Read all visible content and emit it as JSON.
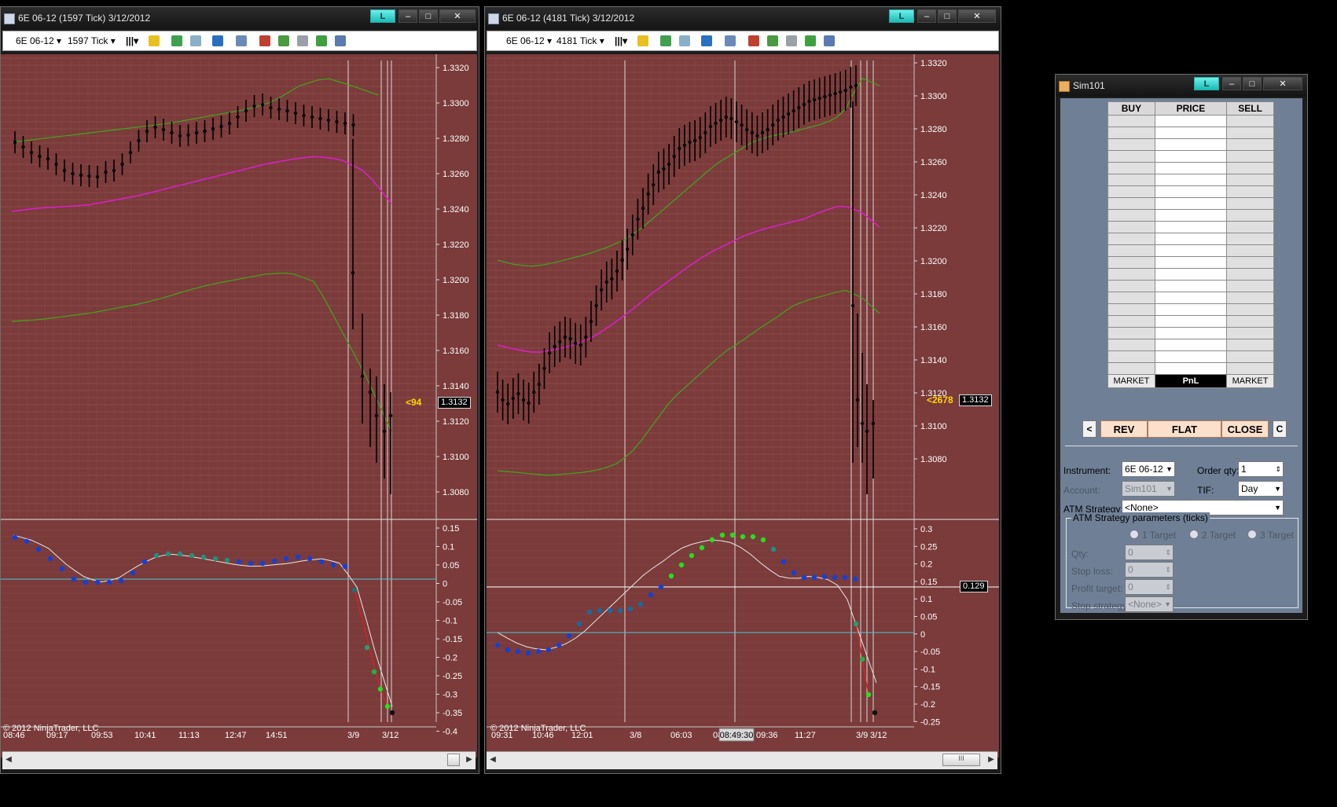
{
  "chart1": {
    "title": "6E 06-12 (1597 Tick)  3/12/2012",
    "instrument": "6E 06-12",
    "period": "1597 Tick",
    "copyright": "© 2012 NinjaTrader, LLC",
    "last_price_tag": "1.3132",
    "counter_tag": "<94",
    "price_ticks": [
      "1.3320",
      "1.3300",
      "1.3280",
      "1.3260",
      "1.3240",
      "1.3220",
      "1.3200",
      "1.3180",
      "1.3160",
      "1.3140",
      "1.3120",
      "1.3100",
      "1.3080"
    ],
    "osc_ticks": [
      "0.15",
      "0.1",
      "0.05",
      "0",
      "-0.05",
      "-0.1",
      "-0.15",
      "-0.2",
      "-0.25",
      "-0.3",
      "-0.35",
      "-0.4"
    ],
    "x_labels": [
      "08:46",
      "09:17",
      "09:53",
      "10:41",
      "11:13",
      "12:47",
      "14:51",
      "3/9",
      "3/12"
    ]
  },
  "chart2": {
    "title": "6E 06-12 (4181 Tick)  3/12/2012",
    "instrument": "6E 06-12",
    "period": "4181 Tick",
    "copyright": "© 2012 NinjaTrader, LLC",
    "last_price_tag": "1.3132",
    "counter_tag": "<2678",
    "osc_value_tag": "0.129",
    "price_ticks": [
      "1.3320",
      "1.3300",
      "1.3280",
      "1.3260",
      "1.3240",
      "1.3220",
      "1.3200",
      "1.3180",
      "1.3160",
      "1.3140",
      "1.3120",
      "1.3100",
      "1.3080"
    ],
    "osc_ticks": [
      "0.3",
      "0.25",
      "0.2",
      "0.15",
      "0.1",
      "0.05",
      "0",
      "-0.05",
      "-0.1",
      "-0.15",
      "-0.2",
      "-0.25"
    ],
    "x_labels": [
      "09:31",
      "10:46",
      "12:01",
      "3/8",
      "06:03",
      "08",
      "09:36",
      "11:27",
      "3/9",
      "3/12"
    ],
    "crosshair_time": "08:49:30"
  },
  "sim": {
    "title": "Sim101",
    "headers": [
      "BUY",
      "PRICE",
      "SELL"
    ],
    "bottom_row": [
      "MARKET",
      "PnL",
      "MARKET"
    ],
    "buttons": {
      "left": "<",
      "rev": "REV",
      "flat": "FLAT",
      "close": "CLOSE",
      "right": "C"
    },
    "instrument_label": "Instrument:",
    "instrument_value": "6E 06-12",
    "orderqty_label": "Order qty:",
    "orderqty_value": "1",
    "account_label": "Account:",
    "account_value": "Sim101",
    "tif_label": "TIF:",
    "tif_value": "Day",
    "atm_label": "ATM Strategy:",
    "atm_value": "<None>",
    "group_title": "ATM Strategy parameters (ticks)",
    "targets": [
      "1 Target",
      "2 Target",
      "3 Target"
    ],
    "qty_label": "Qty:",
    "qty_value": "0",
    "stoploss_label": "Stop loss:",
    "stoploss_value": "0",
    "profit_label": "Profit target:",
    "profit_value": "0",
    "stopstrategy_label": "Stop strategy:",
    "stopstrategy_value": "<None>"
  },
  "window_buttons": {
    "lock": "L",
    "min": "–",
    "max": "□",
    "close": "✕"
  },
  "scroll_thumb": "III",
  "colors": {
    "chart_bg": "#7a3b3a",
    "band": "#3fa81a",
    "ma": "#d820c8",
    "dot_blue": "#1440d8",
    "dot_green": "#22e01c",
    "zero_line": "#4cc8d8"
  }
}
